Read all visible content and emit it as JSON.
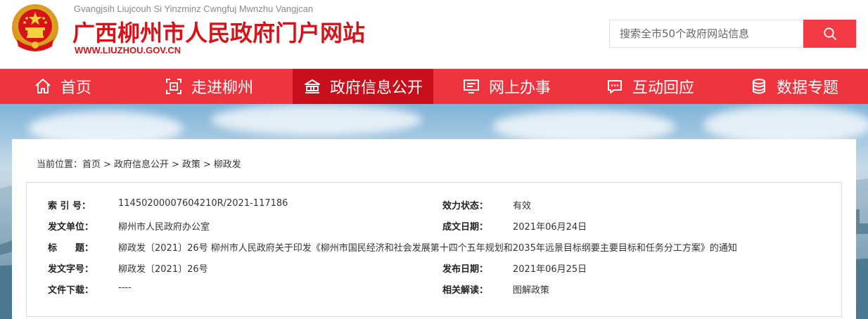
{
  "site": {
    "zhuang_name": "Gvangjsih Liujcouh Si Yinzminz Cwngfuj Mwnzhu Vangjcan",
    "name": "广西柳州市人民政府门户网站",
    "url": "WWW.LIUZHOU.GOV.CN"
  },
  "search": {
    "placeholder": "搜索全市50个政府网站信息"
  },
  "nav": {
    "items": [
      {
        "label": "首页",
        "icon": "home-icon"
      },
      {
        "label": "走进柳州",
        "icon": "scan-icon"
      },
      {
        "label": "政府信息公开",
        "icon": "building-icon"
      },
      {
        "label": "网上办事",
        "icon": "monitor-icon"
      },
      {
        "label": "互动回应",
        "icon": "chat-icon"
      },
      {
        "label": "数据专题",
        "icon": "database-icon"
      }
    ],
    "active_index": 2
  },
  "breadcrumb": {
    "prefix": "当前位置：",
    "items": [
      "首页",
      "政府信息公开",
      "政策",
      "柳政发"
    ],
    "separator": ">"
  },
  "document_info": {
    "index_label": "索 引 号：",
    "index_value": "11450200007604210R/2021-117186",
    "status_label": "效力状态：",
    "status_value": "有效",
    "issuer_label": "发文单位：",
    "issuer_value": "柳州市人民政府办公室",
    "created_label": "成文日期：",
    "created_value": "2021年06月24日",
    "title_label": "标　　题：",
    "title_value": "柳政发〔2021〕26号 柳州市人民政府关于印发《柳州市国民经济和社会发展第十四个五年规划和2035年远景目标纲要主要目标和任务分工方案》的通知",
    "doc_no_label": "发文字号：",
    "doc_no_value": "柳政发〔2021〕26号",
    "published_label": "发布日期：",
    "published_value": "2021年06月25日",
    "download_label": "文件下载：",
    "download_value": "----",
    "interpretation_label": "相关解读：",
    "interpretation_value": "图解政策"
  },
  "colors": {
    "brand_red": "#d7131a",
    "nav_red": "#ee343f",
    "nav_active": "#c8101c",
    "search_button": "#f23b45"
  }
}
